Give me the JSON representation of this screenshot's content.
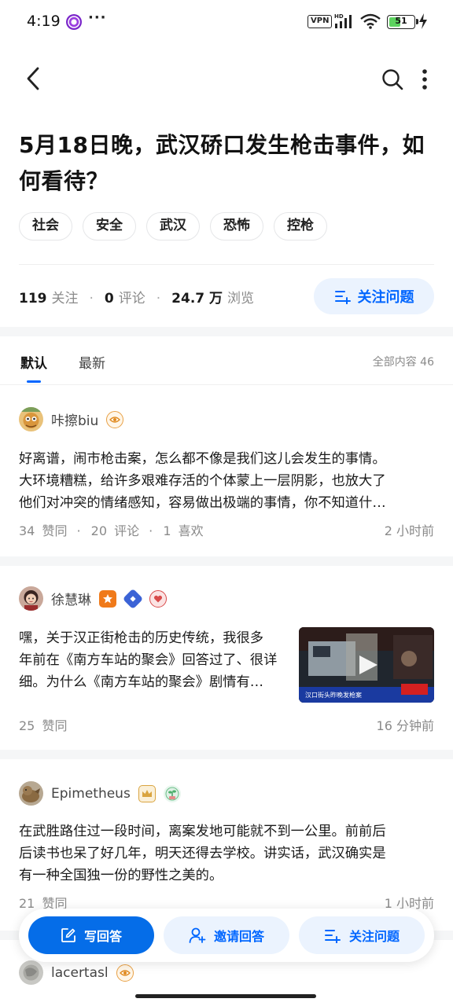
{
  "status_bar": {
    "time": "4:19",
    "more": "···",
    "vpn": "VPN",
    "hd": "HD",
    "battery": "51",
    "battery_level": 0.51
  },
  "question": {
    "title": "5月18日晚，武汉硚口发生枪击事件，如何看待？",
    "tags": [
      "社会",
      "安全",
      "武汉",
      "恐怖",
      "控枪"
    ],
    "stats": {
      "followers_num": "119",
      "followers_label": "关注",
      "comments_num": "0",
      "comments_label": "评论",
      "views_num": "24.7 万",
      "views_label": "浏览"
    },
    "follow_label": "关注问题"
  },
  "tabs": {
    "default": "默认",
    "latest": "最新",
    "total": "全部内容 46"
  },
  "answers": [
    {
      "author": "咔擦biu",
      "excerpt_lines": [
        "好离谱，闹市枪击案，怎么都不像是我们这儿会发生的事情。",
        "大环境糟糕，给许多艰难存活的个体蒙上一层阴影，也放大了",
        "他们对冲突的情绪感知，容易做出极端的事情，你不知道什…"
      ],
      "likes": "34",
      "likes_label": "赞同",
      "comments": "20",
      "comments_label": "评论",
      "favs": "1",
      "favs_label": "喜欢",
      "time": "2 小时前"
    },
    {
      "author": "徐慧琳",
      "excerpt_lines": [
        "嘿，关于汉正街枪击的历史传统，我很多",
        "年前在《南方车站的聚会》回答过了、很详",
        "细。为什么《南方车站的聚会》剧情有…"
      ],
      "likes": "25",
      "likes_label": "赞同",
      "time": "16 分钟前",
      "video_caption": "汉口街头昨晚发枪案"
    },
    {
      "author": "Epimetheus",
      "excerpt_lines": [
        "在武胜路住过一段时间，离案发地可能就不到一公里。前前后",
        "后读书也呆了好几年，明天还得去学校。讲实话，武汉确实是",
        "有一种全国独一份的野性之美的。"
      ],
      "likes": "21",
      "likes_label": "赞同",
      "time": "1 小时前"
    },
    {
      "author": "lacertasl"
    }
  ],
  "action_bar": {
    "write": "写回答",
    "invite": "邀请回答",
    "follow": "关注问题"
  }
}
